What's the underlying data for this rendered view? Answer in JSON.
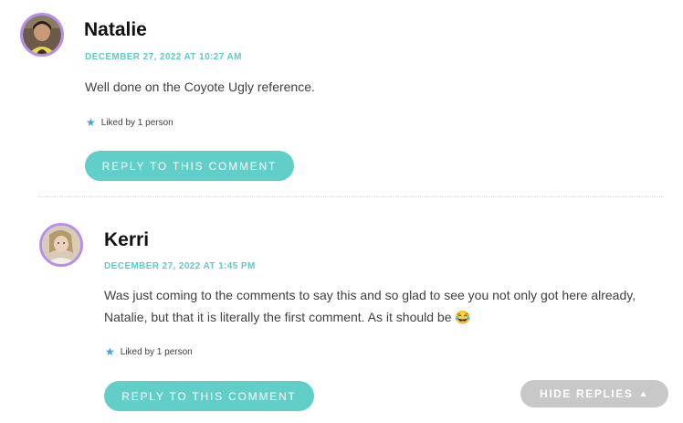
{
  "comments": [
    {
      "author": "Natalie",
      "date": "DECEMBER 27, 2022 AT 10:27 AM",
      "text": "Well done on the Coyote Ugly reference.",
      "likes": "Liked by 1 person",
      "reply_label": "REPLY TO THIS COMMENT"
    },
    {
      "author": "Kerri",
      "date": "DECEMBER 27, 2022 AT 1:45 PM",
      "text_line1": "Was just coming to the comments to say this and so glad to see you not only got here already,",
      "text_line2": "Natalie, but that it is literally the first comment. As it should be 😂",
      "likes": "Liked by 1 person",
      "reply_label": "REPLY TO THIS COMMENT"
    }
  ],
  "hide_replies": {
    "label": "HIDE REPLIES",
    "icon": "▲"
  },
  "icons": {
    "like": "star-icon"
  },
  "colors": {
    "accent": "#62cec8",
    "date": "#5dcbc7",
    "avatar_ring": "#b690e8",
    "hide_button": "#c8c8c8"
  }
}
